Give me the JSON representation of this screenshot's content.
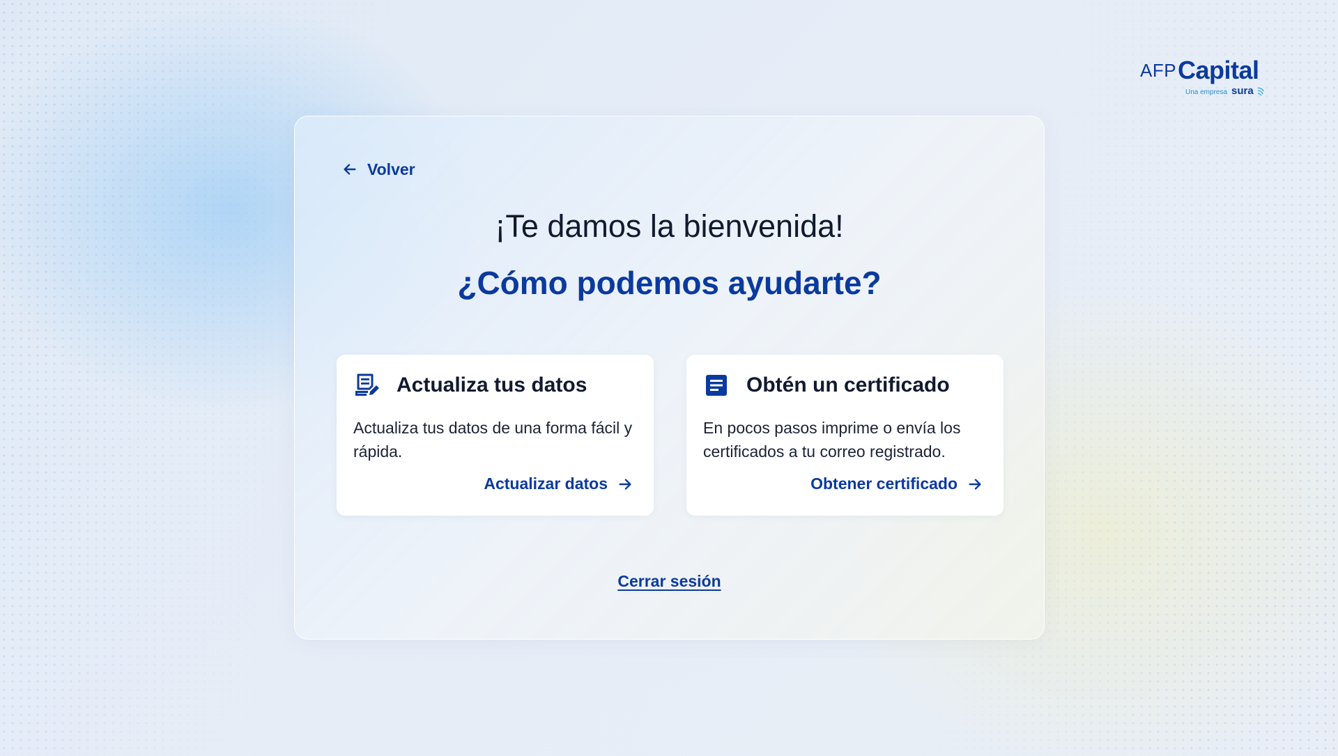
{
  "brand": {
    "afp": "AFP",
    "capital": "Capital",
    "tagline": "Una empresa",
    "parent": "sura"
  },
  "nav": {
    "back_label": "Volver"
  },
  "main": {
    "title": "¡Te damos la bienvenida!",
    "subtitle": "¿Cómo podemos ayudarte?",
    "cards": [
      {
        "icon": "document-edit-icon",
        "heading": "Actualiza tus datos",
        "description": "Actualiza tus datos de una forma fácil y rápida.",
        "action": "Actualizar datos"
      },
      {
        "icon": "certificate-document-icon",
        "heading": "Obtén un certificado",
        "description": "En pocos pasos imprime o envía los certificados a tu correo registrado.",
        "action": "Obtener certificado"
      }
    ],
    "logout_label": "Cerrar sesión"
  },
  "colors": {
    "primary": "#0b3a9e",
    "text": "#111a2e",
    "accent": "#1f8fd0"
  }
}
